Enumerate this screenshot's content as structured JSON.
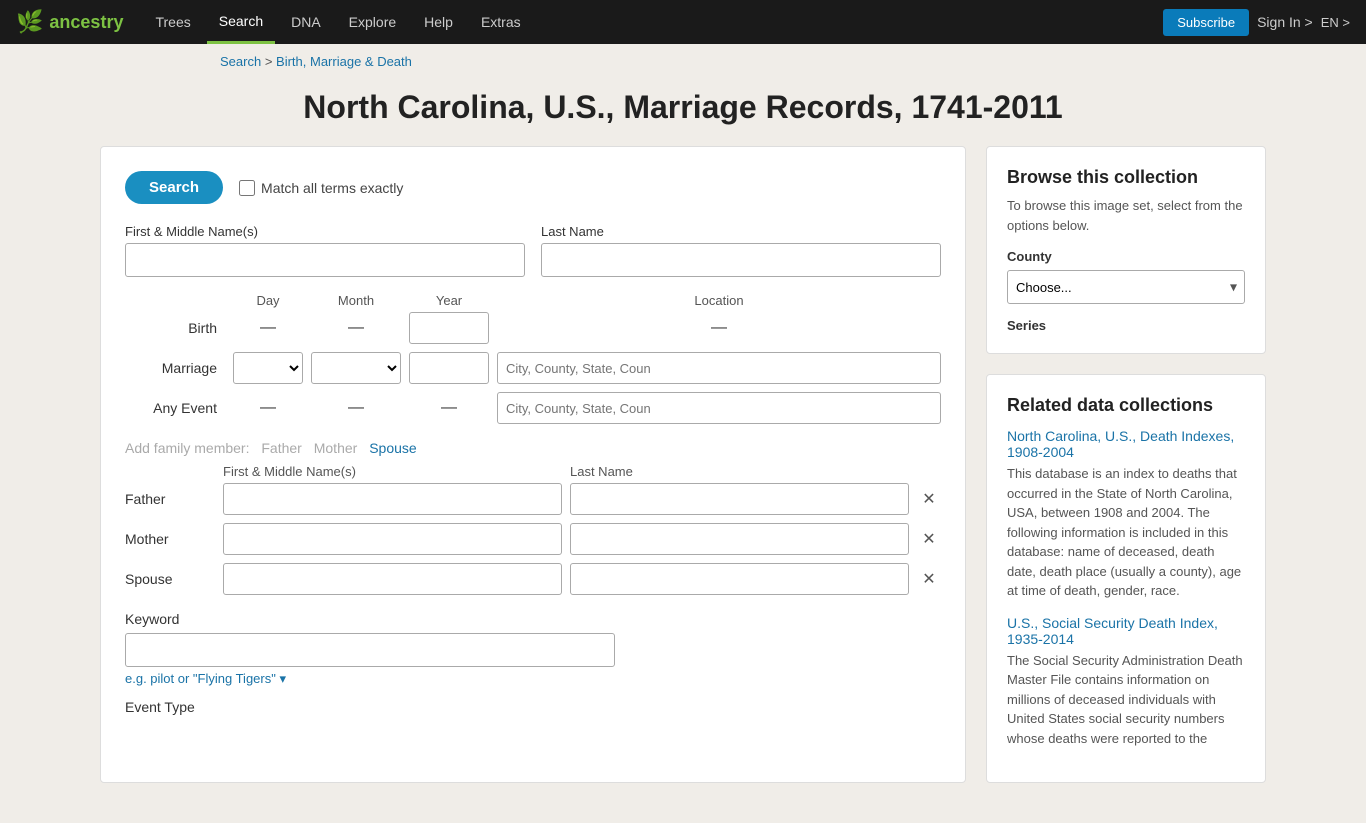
{
  "nav": {
    "logo_text": "ancestry",
    "links": [
      "Trees",
      "Search",
      "DNA",
      "Explore",
      "Help",
      "Extras"
    ],
    "active_link": "Search",
    "subscribe_label": "Subscribe",
    "signin_label": "Sign In >",
    "lang_label": "EN >"
  },
  "breadcrumb": {
    "search_label": "Search",
    "separator": " > ",
    "link_label": "Birth, Marriage & Death"
  },
  "page": {
    "title": "North Carolina, U.S., Marriage Records, 1741-2011"
  },
  "search_panel": {
    "search_button": "Search",
    "match_exact_label": "Match all terms exactly",
    "first_middle_label": "First & Middle Name(s)",
    "last_name_label": "Last Name",
    "events_header": {
      "day_col": "Day",
      "month_col": "Month",
      "year_col": "Year",
      "location_col": "Location"
    },
    "events": [
      {
        "name": "Birth",
        "has_dropdowns": false,
        "location_placeholder": ""
      },
      {
        "name": "Marriage",
        "has_dropdowns": true,
        "location_placeholder": "City, County, State, Coun"
      },
      {
        "name": "Any Event",
        "has_dropdowns": false,
        "location_placeholder": "City, County, State, Coun"
      }
    ],
    "family_header": "Add family member:",
    "family_links": [
      "Father",
      "Mother",
      "Spouse"
    ],
    "family_cols": [
      "First & Middle Name(s)",
      "Last Name"
    ],
    "family_rows": [
      "Father",
      "Mother",
      "Spouse"
    ],
    "keyword_label": "Keyword",
    "keyword_placeholder": "",
    "keyword_hint": "e.g. pilot or \"Flying Tigers\" ▾",
    "event_type_label": "Event Type"
  },
  "browse_box": {
    "title": "Browse this collection",
    "desc": "To browse this image set, select from the options below.",
    "county_label": "County",
    "county_default": "Choose...",
    "series_label": "Series"
  },
  "related_box": {
    "title": "Related data collections",
    "items": [
      {
        "link_text": "North Carolina, U.S., Death Indexes, 1908-2004",
        "desc": "This database is an index to deaths that occurred in the State of North Carolina, USA, between 1908 and 2004. The following information is included in this database: name of deceased, death date, death place (usually a county), age at time of death, gender, race."
      },
      {
        "link_text": "U.S., Social Security Death Index, 1935-2014",
        "desc": "The Social Security Administration Death Master File contains information on millions of deceased individuals with United States social security numbers whose deaths were reported to the"
      }
    ]
  }
}
